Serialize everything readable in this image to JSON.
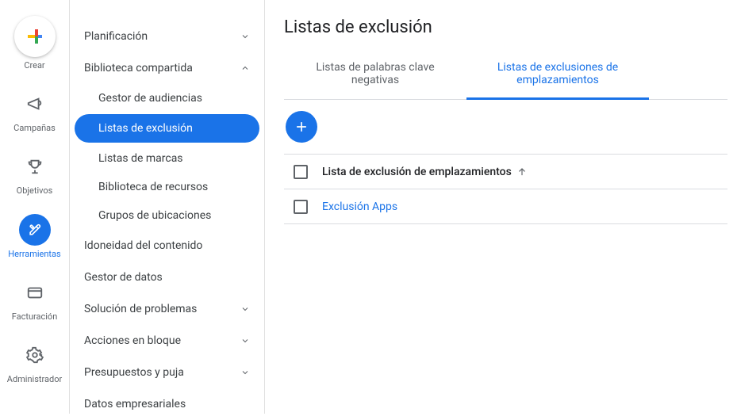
{
  "rail": {
    "create": "Crear",
    "items": [
      {
        "label": "Campañas"
      },
      {
        "label": "Objetivos"
      },
      {
        "label": "Herramientas"
      },
      {
        "label": "Facturación"
      },
      {
        "label": "Administrador"
      }
    ]
  },
  "sidebar": {
    "groups": [
      {
        "label": "Planificación"
      },
      {
        "label": "Biblioteca compartida"
      },
      {
        "label": "Idoneidad del contenido"
      },
      {
        "label": "Gestor de datos"
      },
      {
        "label": "Solución de problemas"
      },
      {
        "label": "Acciones en bloque"
      },
      {
        "label": "Presupuestos y puja"
      },
      {
        "label": "Datos empresariales"
      }
    ],
    "shared_sub": [
      {
        "label": "Gestor de audiencias"
      },
      {
        "label": "Listas de exclusión"
      },
      {
        "label": "Listas de marcas"
      },
      {
        "label": "Biblioteca de recursos"
      },
      {
        "label": "Grupos de ubicaciones"
      }
    ]
  },
  "main": {
    "title": "Listas de exclusión",
    "tabs": [
      {
        "label": "Listas de palabras clave negativas"
      },
      {
        "label": "Listas de exclusiones de emplazamientos"
      }
    ],
    "table": {
      "header": "Lista de exclusión de emplazamientos",
      "rows": [
        {
          "name": "Exclusión Apps"
        }
      ]
    }
  }
}
